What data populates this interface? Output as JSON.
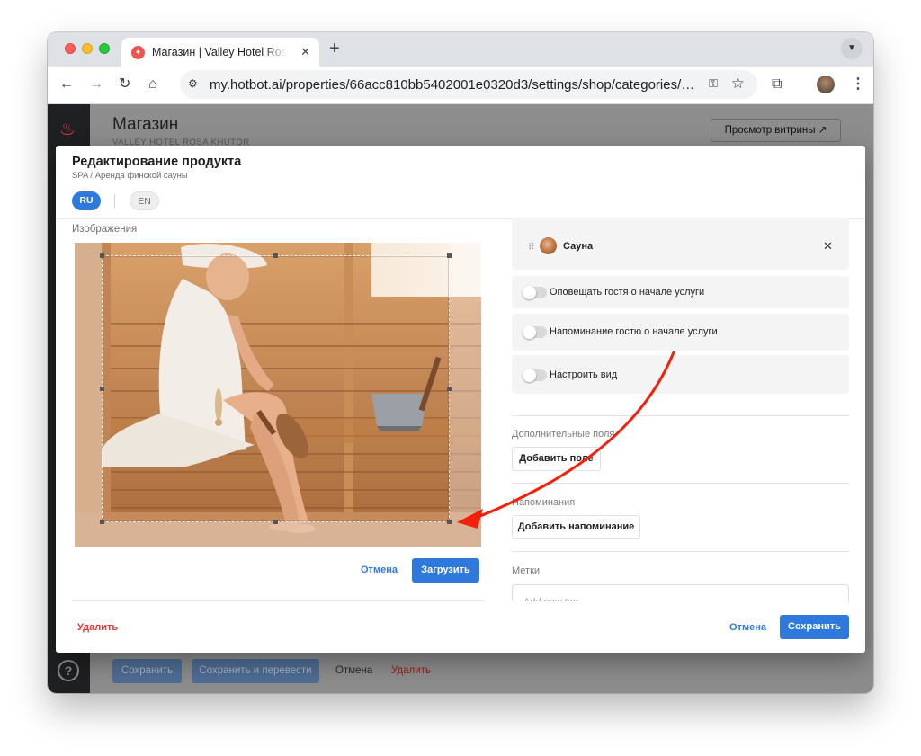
{
  "browser": {
    "tab_title": "Магазин | Valley Hotel Rosa Khutor",
    "url": "my.hotbot.ai/properties/66acc810bb5402001e0320d3/settings/shop/categories/66a..."
  },
  "app": {
    "page_title": "Магазин",
    "page_subtitle": "VALLEY HOTEL ROSA KHUTOR",
    "preview_button": "Просмотр витрины ↗",
    "help_label": "?",
    "bottom_bar": {
      "save": "Сохранить",
      "save_translate": "Сохранить и перевести",
      "cancel": "Отмена",
      "delete": "Удалить"
    }
  },
  "modal": {
    "title": "Редактирование продукта",
    "breadcrumb": "SPA / Аренда финской сауны",
    "languages": {
      "active": "RU",
      "other": "EN"
    },
    "images_label": "Изображения",
    "crop_cancel": "Отмена",
    "crop_upload": "Загрузить",
    "delete": "Удалить",
    "cancel": "Отмена",
    "save": "Сохранить",
    "linked_item": "Сауна",
    "toggles": [
      {
        "label": "Оповещать гостя о начале услуги",
        "on": false
      },
      {
        "label": "Напоминание гостю о начале услуги",
        "on": false
      },
      {
        "label": "Настроить вид",
        "on": false
      }
    ],
    "extra_fields": {
      "label": "Дополнительные поля",
      "button": "Добавить поле"
    },
    "reminders": {
      "label": "Напоминания",
      "button": "Добавить напоминание"
    },
    "tags": {
      "label": "Метки",
      "placeholder": "Add new tag"
    }
  },
  "colors": {
    "primary": "#2f79dc",
    "danger": "#e53935",
    "annotation_arrow": "#f2210b"
  }
}
